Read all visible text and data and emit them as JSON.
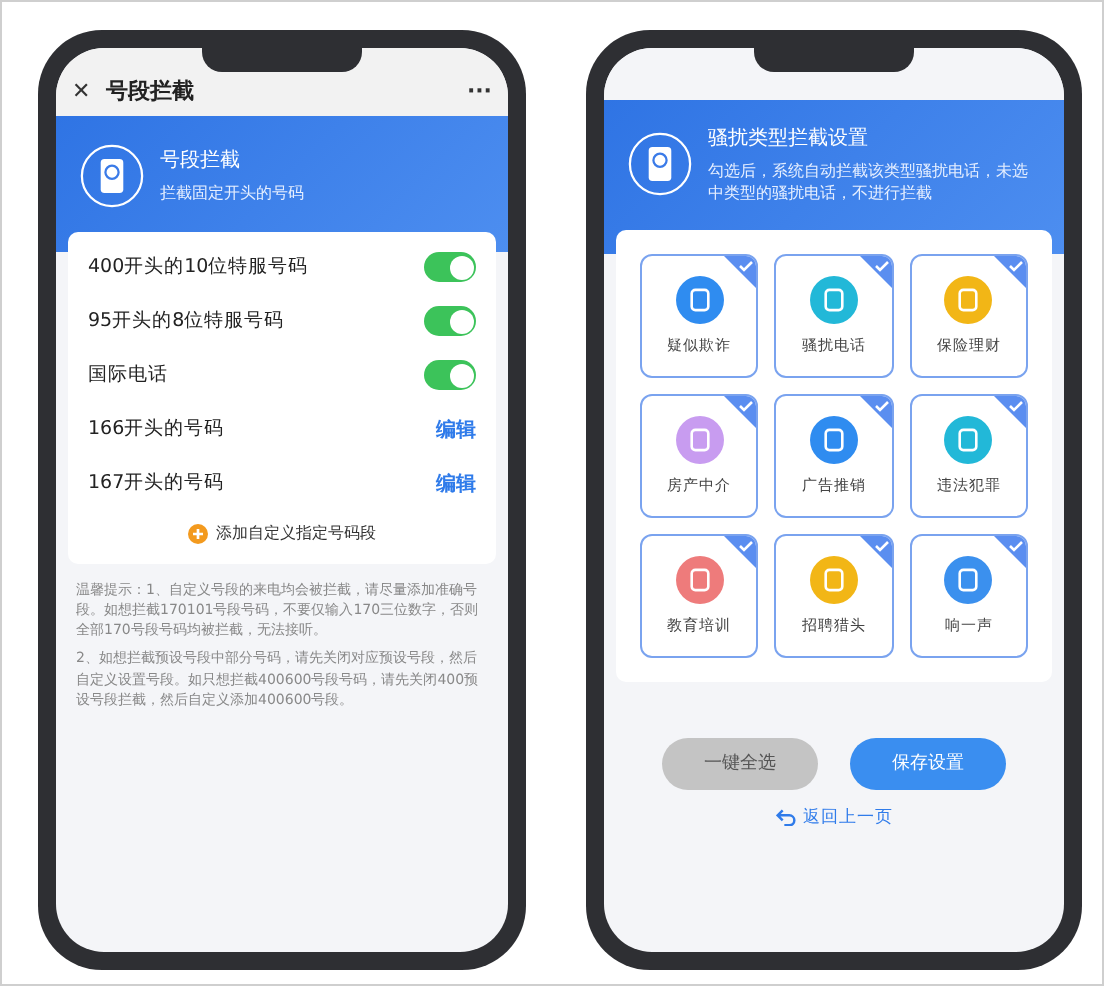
{
  "left_screen": {
    "nav": {
      "close": "✕",
      "title": "号段拦截",
      "more": "···"
    },
    "header": {
      "title": "号段拦截",
      "subtitle": "拦截固定开头的号码"
    },
    "rules": [
      {
        "kind": "toggle",
        "label": "400开头的10位特服号码",
        "on": true
      },
      {
        "kind": "toggle",
        "label": "95开头的8位特服号码",
        "on": true
      },
      {
        "kind": "toggle",
        "label": "国际电话",
        "on": true
      },
      {
        "kind": "edit",
        "label": "166开头的号码",
        "action": "编辑"
      },
      {
        "kind": "edit",
        "label": "167开头的号码",
        "action": "编辑"
      }
    ],
    "add_button": "添加自定义指定号码段",
    "tips": [
      "温馨提示：1、自定义号段的来电均会被拦截，请尽量添加准确号段。如想拦截170101号段号码，不要仅输入170三位数字，否则全部170号段号码均被拦截，无法接听。",
      "2、如想拦截预设号段中部分号码，请先关闭对应预设号段，然后自定义设置号段。如只想拦截400600号段号码，请先关闭400预设号段拦截，然后自定义添加400600号段。"
    ]
  },
  "right_screen": {
    "header": {
      "title": "骚扰类型拦截设置",
      "subtitle": "勾选后，系统自动拦截该类型骚扰电话，未选中类型的骚扰电话，不进行拦截"
    },
    "tiles": [
      {
        "label": "疑似欺诈",
        "color": "#2f8cf0",
        "checked": true
      },
      {
        "label": "骚扰电话",
        "color": "#22b8d8",
        "checked": true
      },
      {
        "label": "保险理财",
        "color": "#f2b616",
        "checked": true
      },
      {
        "label": "房产中介",
        "color": "#c89cf0",
        "checked": true
      },
      {
        "label": "广告推销",
        "color": "#2f8cf0",
        "checked": true
      },
      {
        "label": "违法犯罪",
        "color": "#22b8d8",
        "checked": true
      },
      {
        "label": "教育培训",
        "color": "#ee7b7b",
        "checked": true
      },
      {
        "label": "招聘猎头",
        "color": "#f2b616",
        "checked": true
      },
      {
        "label": "响一声",
        "color": "#3b90ee",
        "checked": true
      }
    ],
    "buttons": [
      {
        "label": "一键全选",
        "disabled": true
      },
      {
        "label": "保存设置",
        "disabled": false
      }
    ],
    "back_link": "返回上一页"
  }
}
